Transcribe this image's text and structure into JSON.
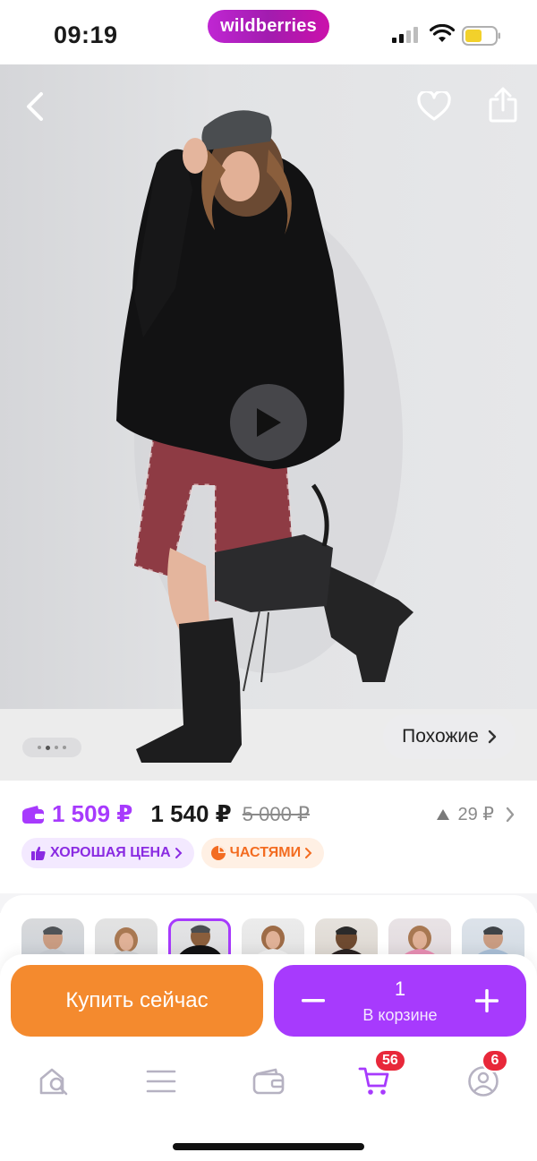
{
  "status_bar": {
    "time": "09:19",
    "brand": "wildberries"
  },
  "hero": {
    "icons": {
      "back": "chevron-left-icon",
      "favorite": "heart-icon",
      "share": "share-icon",
      "play": "play-icon"
    },
    "pager_dots": 4,
    "active_dot": 1,
    "similar_label": "Похожие"
  },
  "price": {
    "wallet_price": "1 509 ₽",
    "current_price": "1 540 ₽",
    "old_price": "5 000 ₽",
    "price_change": "29 ₽",
    "badges": [
      {
        "label": "ХОРОШАЯ ЦЕНА",
        "icon": "thumbs-up-icon",
        "color": "#8a2be2"
      },
      {
        "label": "ЧАСТЯМИ",
        "icon": "pie-chart-icon",
        "color": "#f36c21"
      }
    ]
  },
  "thumbnails": {
    "count": 7,
    "active_index": 2
  },
  "actions": {
    "buy_now_label": "Купить сейчас",
    "cart_quantity": "1",
    "cart_label": "В корзине",
    "buy_color": "#f48a2e",
    "cart_color": "#a73afd"
  },
  "tab_bar": {
    "tabs": [
      {
        "name": "home",
        "icon": "search-home-icon"
      },
      {
        "name": "catalog",
        "icon": "menu-icon"
      },
      {
        "name": "wallet",
        "icon": "wallet-icon"
      },
      {
        "name": "cart",
        "icon": "cart-icon",
        "badge": "56",
        "active": true
      },
      {
        "name": "profile",
        "icon": "profile-icon",
        "badge": "6"
      }
    ]
  },
  "accent_color": "#a73afd"
}
